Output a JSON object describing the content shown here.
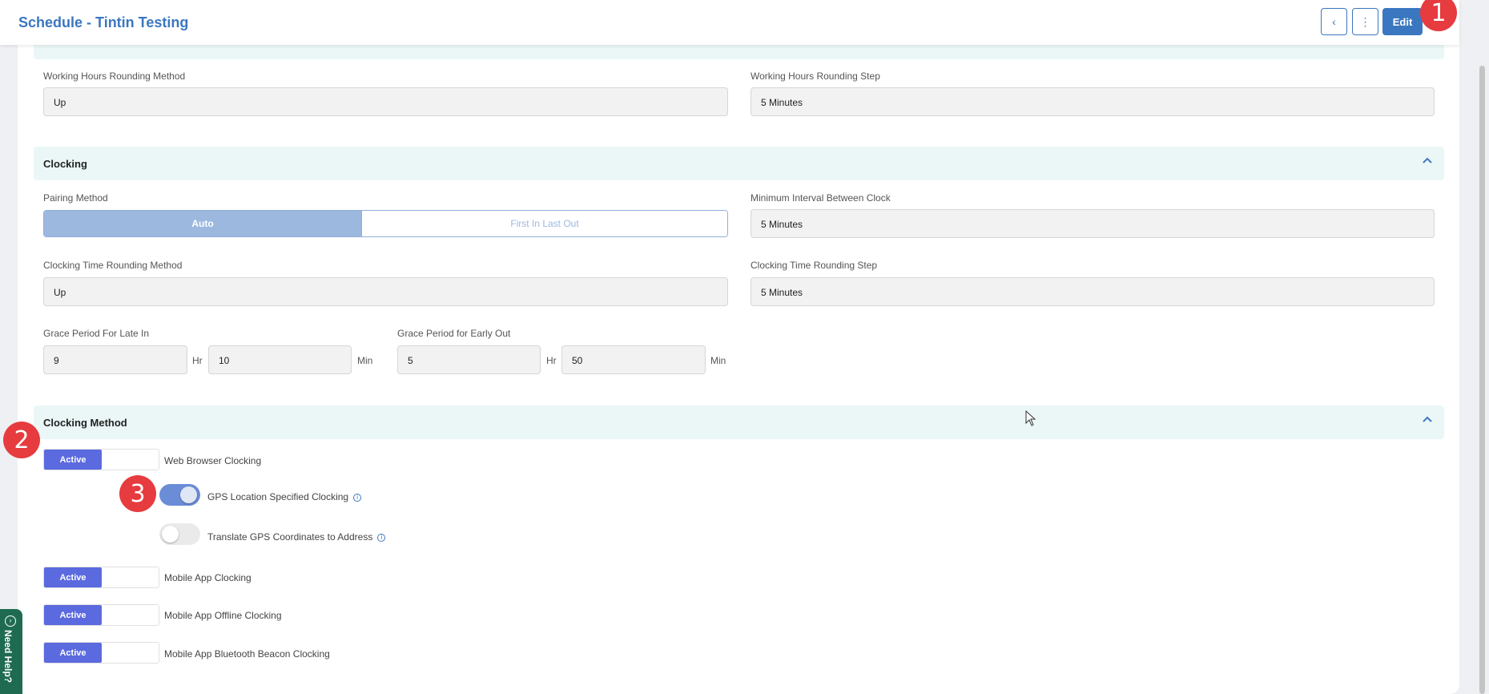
{
  "header": {
    "title": "Schedule - Tintin Testing",
    "back_icon": "‹",
    "more_icon": "⋮",
    "edit_label": "Edit"
  },
  "markers": [
    "1",
    "2",
    "3"
  ],
  "rounding": {
    "method_label": "Working Hours Rounding Method",
    "method_value": "Up",
    "step_label": "Working Hours Rounding Step",
    "step_value": "5 Minutes"
  },
  "clocking": {
    "section_title": "Clocking",
    "pairing_label": "Pairing Method",
    "pairing_options": [
      "Auto",
      "First In Last Out"
    ],
    "min_interval_label": "Minimum Interval Between Clock",
    "min_interval_value": "5 Minutes",
    "time_rounding_label": "Clocking Time Rounding Method",
    "time_rounding_value": "Up",
    "time_step_label": "Clocking Time Rounding Step",
    "time_step_value": "5 Minutes",
    "late_in_label": "Grace Period For Late In",
    "late_in_hr": "9",
    "late_in_min": "10",
    "early_out_label": "Grace Period for Early Out",
    "early_out_hr": "5",
    "early_out_min": "50",
    "hr_unit": "Hr",
    "min_unit": "Min"
  },
  "clocking_method": {
    "section_title": "Clocking Method",
    "active_label": "Active",
    "web_browser": "Web Browser Clocking",
    "gps_specified": "GPS Location Specified Clocking",
    "gps_translate": "Translate GPS Coordinates to Address",
    "mobile_app": "Mobile App Clocking",
    "mobile_offline": "Mobile App Offline Clocking",
    "mobile_beacon": "Mobile App Bluetooth Beacon Clocking",
    "gps_specified_on": true,
    "gps_translate_on": false
  },
  "help": {
    "label": "Need Help?"
  },
  "colors": {
    "accent": "#3b77c0",
    "active": "#5b6adf",
    "marker": "#e63b3f",
    "section": "#eaf7f6"
  }
}
